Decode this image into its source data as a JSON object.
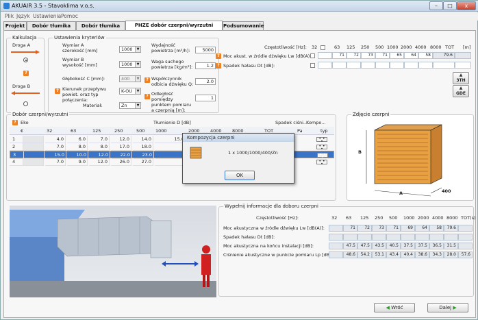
{
  "window": {
    "title": "AKUAIR 3.5 - Stavoklima v.o.s.",
    "minimize": "–",
    "maximize": "□",
    "close": "x"
  },
  "menu": [
    "Plik",
    "Język",
    "Ustawienia",
    "Pomoc"
  ],
  "tabs": [
    "Projekt",
    "Dobór tłumika 3TH",
    "Dobór tłumika GDE",
    "PHZE dobór czerpni/wyrzutni tłumiących",
    "Podsumowanie"
  ],
  "kalkulacja": {
    "legend": "Kalkulacja",
    "droga_a": "Droga A",
    "droga_b": "Droga B",
    "help": "?"
  },
  "kryteria": {
    "legend": "Ustawienia kryteriów",
    "wymiar_a_label": "Wymiar A szerokość [mm]",
    "wymiar_a": "1000",
    "wymiar_b_label": "Wymiar B wysokość [mm]",
    "wymiar_b": "1000",
    "glebokosc_label": "Głębokość C [mm]:",
    "glebokosc": "400",
    "kierunek_label": "Kierunek przepływu powiet. oraz typ połączenia:",
    "kierunek": "K-OU",
    "material_label": "Materiał:",
    "material": "Zn",
    "wydajnosc_label": "Wydajność powietrza [m³/h]:",
    "wydajnosc": "5000",
    "waga_label": "Waga suchego powietrza [kg/m³]:",
    "waga": "1.2",
    "wspolczynnik_label": "Współczynnik odbicia dźwięku Q:",
    "wspolczynnik": "2.0",
    "odleglosc_label": "Odległość pomiędzy punktem pomiaru a czerpnią [m]:",
    "odleglosc": "1",
    "help": "?"
  },
  "freq_panel": {
    "czestotliwosc_label": "Częstotliwość [Hz]:",
    "freqs": [
      "32",
      "63",
      "125",
      "250",
      "500",
      "1000",
      "2000",
      "4000",
      "8000",
      "TOT",
      "[m]"
    ],
    "moc_label": "Moc akust. w źródle dźwięku Lw [dB(A)]:",
    "moc_values": [
      "",
      "71",
      "72",
      "73",
      "71",
      "65",
      "64",
      "58",
      "79.6"
    ],
    "spadek_label": "Spadek hałasu Dt [dB]:",
    "btn_3th": "3TH",
    "btn_gde": "GDE",
    "up": "▲",
    "down": "▲"
  },
  "dobor": {
    "legend": "Dobór czerpni/wyrzutni",
    "eko": "Eko",
    "tlumienie": "Tłumienie D [dB]",
    "spadek": "Spadek ciśni...",
    "kompo": "Kompo...",
    "headers": [
      "€",
      "32",
      "63",
      "125",
      "250",
      "500",
      "1000",
      "2000",
      "4000",
      "8000",
      "TOT",
      "Pa",
      "typ"
    ],
    "rows": [
      {
        "n": "1",
        "v": [
          "",
          "4.0",
          "6.0",
          "7.0",
          "12.0",
          "14.0",
          "15.0",
          "",
          "",
          "",
          "12.8"
        ],
        "btn": "• • •"
      },
      {
        "n": "2",
        "v": [
          "",
          "7.0",
          "8.0",
          "8.0",
          "17.0",
          "18.0",
          "",
          "",
          "",
          "",
          "13.9"
        ],
        "btn": "• • •"
      },
      {
        "n": "3",
        "v": [
          "",
          "15.0",
          "10.0",
          "12.0",
          "22.0",
          "23.0",
          "",
          "",
          "",
          "",
          "20.8"
        ],
        "btn": "• • •"
      },
      {
        "n": "4",
        "v": [
          "",
          "7.0",
          "9.0",
          "12.0",
          "26.0",
          "27.0",
          "",
          "",
          "",
          "",
          "23.6"
        ],
        "btn": "• • •"
      }
    ],
    "help": "?"
  },
  "zdjecie": {
    "legend": "Zdjęcie czerpni",
    "a_label": "A",
    "b_label": "B",
    "depth_label": "400"
  },
  "modal": {
    "title": "Kompozycja czerpni",
    "text": "1 x 1000/1000/400/Zn",
    "ok": "OK"
  },
  "info": {
    "legend": "Wypełnij informacje dla doboru czerpni",
    "czest_label": "Częstotliwość [Hz]:",
    "freqs": [
      "32",
      "63",
      "125",
      "250",
      "500",
      "1000",
      "2000",
      "4000",
      "8000",
      "TOT(s)"
    ],
    "rows": [
      {
        "label": "Moc akustyczna w źródle dźwięku Lw [dB(A)]:",
        "v": [
          "",
          "71",
          "72",
          "73",
          "71",
          "69",
          "64",
          "58",
          "79.6"
        ]
      },
      {
        "label": "Spadek hałasu Dt [dB]:",
        "v": [
          "",
          "",
          "",
          "",
          "",
          "",
          "",
          "",
          ""
        ]
      },
      {
        "label": "Moc akustyczna na końcu instalacji [dB]:",
        "v": [
          "",
          "47.5",
          "47.5",
          "43.5",
          "40.5",
          "37.5",
          "37.5",
          "36.5",
          "31.5"
        ]
      },
      {
        "label": "Ciśnienie akustyczne w punkcie pomiaru Lp [dB(A)]:",
        "v": [
          "",
          "48.6",
          "54.2",
          "53.1",
          "43.4",
          "40.4",
          "38.6",
          "34.3",
          "28.0",
          "57.6"
        ]
      }
    ]
  },
  "nav": {
    "back": "Wróć",
    "next": "Dalej"
  },
  "colors": {
    "accent": "#3a74c8",
    "orange": "#f08020",
    "red": "#d03020"
  }
}
